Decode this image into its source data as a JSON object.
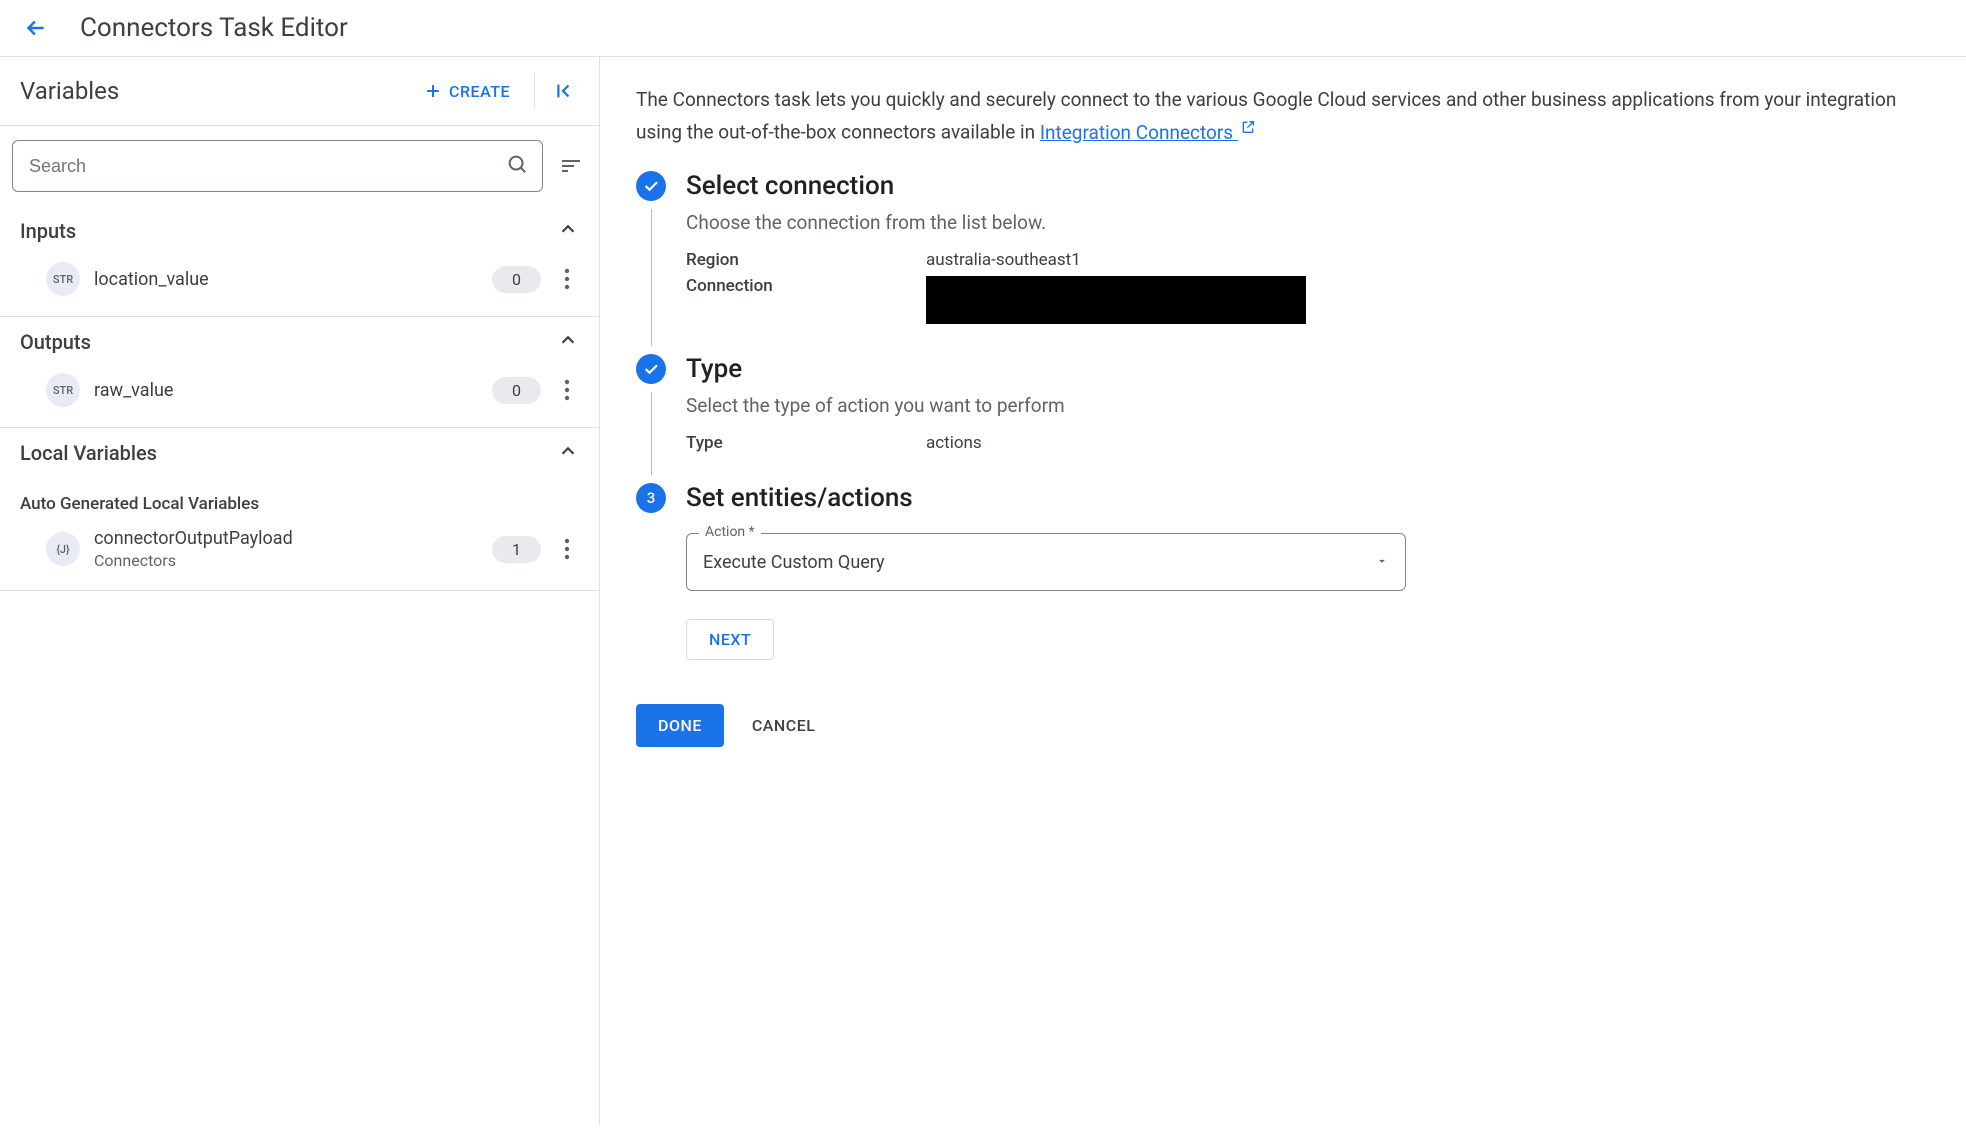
{
  "header": {
    "title": "Connectors Task Editor"
  },
  "sidebar": {
    "title": "Variables",
    "create_label": "CREATE",
    "search_placeholder": "Search",
    "sections": {
      "inputs": {
        "title": "Inputs",
        "items": [
          {
            "type_badge": "STR",
            "name": "location_value",
            "count": "0"
          }
        ]
      },
      "outputs": {
        "title": "Outputs",
        "items": [
          {
            "type_badge": "STR",
            "name": "raw_value",
            "count": "0"
          }
        ]
      },
      "local": {
        "title": "Local Variables",
        "auto_label": "Auto Generated Local Variables",
        "items": [
          {
            "type_badge": "{J}",
            "name": "connectorOutputPayload",
            "subtitle": "Connectors",
            "count": "1"
          }
        ]
      }
    }
  },
  "main": {
    "intro_pre": "The Connectors task lets you quickly and securely connect to the various Google Cloud services and other business applications from your integration using the out-of-the-box connectors available in ",
    "intro_link": "Integration Connectors",
    "steps": {
      "step1": {
        "title": "Select connection",
        "subtitle": "Choose the connection from the list below.",
        "region_label": "Region",
        "region_value": "australia-southeast1",
        "connection_label": "Connection"
      },
      "step2": {
        "title": "Type",
        "subtitle": "Select the type of action you want to perform",
        "type_label": "Type",
        "type_value": "actions"
      },
      "step3": {
        "number": "3",
        "title": "Set entities/actions",
        "action_label": "Action *",
        "action_value": "Execute Custom Query",
        "next_label": "NEXT"
      }
    },
    "footer": {
      "done_label": "DONE",
      "cancel_label": "CANCEL"
    }
  }
}
